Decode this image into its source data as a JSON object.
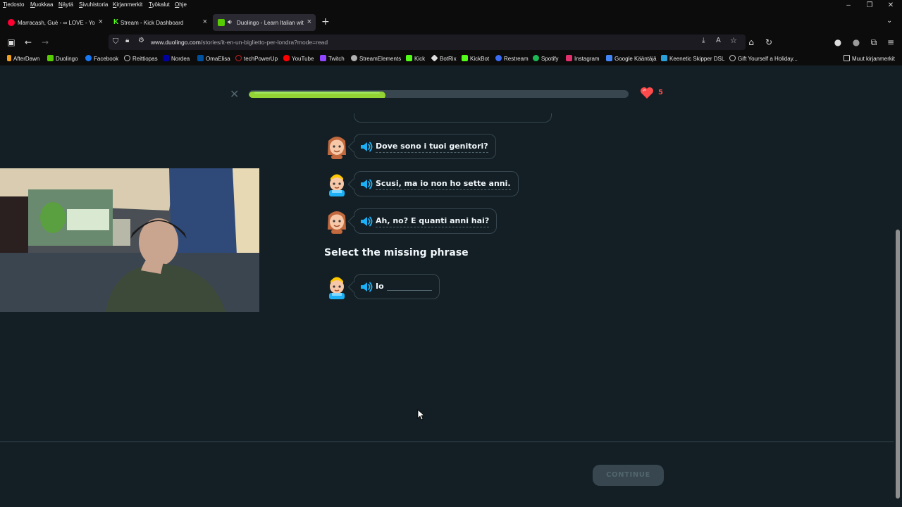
{
  "menubar": {
    "items": [
      "Tiedosto",
      "Muokkaa",
      "Näytä",
      "Sivuhistoria",
      "Kirjanmerkit",
      "Työkalut",
      "Ohje"
    ]
  },
  "tabs": [
    {
      "title": "Marracash, Guè - ∞ LOVE - You",
      "color": "#ff0033"
    },
    {
      "title": "Stream - Kick Dashboard",
      "color": "#53fc18"
    },
    {
      "title": "Duolingo - Learn Italian wit",
      "color": "#58cc02"
    }
  ],
  "address": {
    "host": "www.duolingo.com",
    "path": "/stories/it-en-un-biglietto-per-londra?mode=read"
  },
  "bookmarks": [
    {
      "label": "AfterDawn",
      "color": "#f0a020"
    },
    {
      "label": "Duolingo",
      "color": "#58cc02"
    },
    {
      "label": "Facebook",
      "color": "#1877f2"
    },
    {
      "label": "Reittiopas",
      "color": "#888888"
    },
    {
      "label": "Nordea",
      "color": "#0000a0"
    },
    {
      "label": "OmaElisa",
      "color": "#0050a0"
    },
    {
      "label": "techPowerUp",
      "color": "#d02020"
    },
    {
      "label": "YouTube",
      "color": "#ff0000"
    },
    {
      "label": "Twitch",
      "color": "#9146ff"
    },
    {
      "label": "StreamElements",
      "color": "#b0b0b0"
    },
    {
      "label": "Kick",
      "color": "#53fc18"
    },
    {
      "label": "BotRix",
      "color": "#dddddd"
    },
    {
      "label": "KickBot",
      "color": "#53fc18"
    },
    {
      "label": "Restream",
      "color": "#3a6cf4"
    },
    {
      "label": "Spotify",
      "color": "#1db954"
    },
    {
      "label": "Instagram",
      "color": "#e1306c"
    },
    {
      "label": "Google Kääntäjä",
      "color": "#4285f4"
    },
    {
      "label": "Keenetic Skipper DSL",
      "color": "#2aa0d8"
    },
    {
      "label": "Gift Yourself a Holiday...",
      "color": "#cccccc"
    }
  ],
  "other_bookmarks": "Muut kirjanmerkit",
  "lesson": {
    "progress": 0.36,
    "hearts": "5",
    "lines": [
      {
        "speaker": "female",
        "text": "Dove sono i tuoi genitori?"
      },
      {
        "speaker": "male",
        "text": "Scusi, ma io non ho sette anni."
      },
      {
        "speaker": "female",
        "text": "Ah, no? E quanti anni hai?"
      }
    ],
    "prompt": "Select the missing phrase",
    "answer_line": {
      "speaker": "male",
      "text": "Io"
    },
    "continue_label": "CONTINUE"
  },
  "colors": {
    "background": "#131f24",
    "progress_fill": "#93d333",
    "heart": "#ff4b4b",
    "speaker": "#1cb0f6"
  }
}
